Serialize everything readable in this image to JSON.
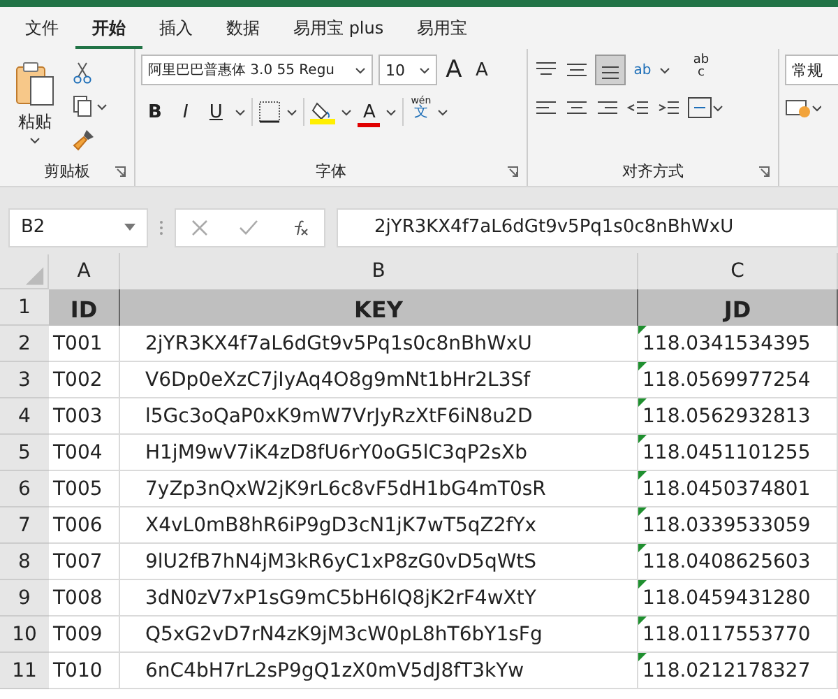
{
  "tabs": [
    {
      "label": "文件",
      "selected": false
    },
    {
      "label": "开始",
      "selected": true
    },
    {
      "label": "插入",
      "selected": false
    },
    {
      "label": "数据",
      "selected": false
    },
    {
      "label": "易用宝 plus",
      "selected": false
    },
    {
      "label": "易用宝",
      "selected": false
    }
  ],
  "ribbon": {
    "clipboard": {
      "paste_label": "粘贴",
      "group_label": "剪贴板"
    },
    "font": {
      "font_name": "阿里巴巴普惠体 3.0 55 Regu",
      "font_size": "10",
      "grow_label": "A",
      "shrink_label": "A",
      "style_buttons": [
        "B",
        "I",
        "U"
      ],
      "color_label": "A",
      "phonetic_label": "wén",
      "phonetic_char": "文",
      "group_label": "字体"
    },
    "alignment": {
      "orientation_label": "ab",
      "wrap_label": "ab",
      "wrap_label_2": "c",
      "group_label": "对齐方式"
    },
    "number": {
      "format": "常规"
    }
  },
  "formula_bar": {
    "name_box": "B2",
    "value": "2jYR3KX4f7aL6dGt9v5Pq1s0c8nBhWxU"
  },
  "sheet": {
    "columns": [
      "A",
      "B",
      "C"
    ],
    "header_row": {
      "number": "1",
      "cells": [
        "ID",
        "KEY",
        "JD"
      ]
    },
    "rows": [
      {
        "number": "2",
        "cells": [
          "T001",
          "2jYR3KX4f7aL6dGt9v5Pq1s0c8nBhWxU",
          "118.0341534395"
        ],
        "flagged": true
      },
      {
        "number": "3",
        "cells": [
          "T002",
          "V6Dp0eXzC7jIyAq4O8g9mNt1bHr2L3Sf",
          "118.0569977254"
        ],
        "flagged": true
      },
      {
        "number": "4",
        "cells": [
          "T003",
          "l5Gc3oQaP0xK9mW7VrJyRzXtF6iN8u2D",
          "118.0562932813"
        ],
        "flagged": true
      },
      {
        "number": "5",
        "cells": [
          "T004",
          "H1jM9wV7iK4zD8fU6rY0oG5lC3qP2sXb",
          "118.0451101255"
        ],
        "flagged": true
      },
      {
        "number": "6",
        "cells": [
          "T005",
          "7yZp3nQxW2jK9rL6c8vF5dH1bG4mT0sR",
          "118.0450374801"
        ],
        "flagged": true
      },
      {
        "number": "7",
        "cells": [
          "T006",
          "X4vL0mB8hR6iP9gD3cN1jK7wT5qZ2fYx",
          "118.0339533059"
        ],
        "flagged": true
      },
      {
        "number": "8",
        "cells": [
          "T007",
          "9lU2fB7hN4jM3kR6yC1xP8zG0vD5qWtS",
          "118.0408625603"
        ],
        "flagged": true
      },
      {
        "number": "9",
        "cells": [
          "T008",
          "3dN0zV7xP1sG9mC5bH6lQ8jK2rF4wXtY",
          "118.0459431280"
        ],
        "flagged": true
      },
      {
        "number": "10",
        "cells": [
          "T009",
          "Q5xG2vD7rN4zK9jM3cW0pL8hT6bY1sFg",
          "118.0117553770"
        ],
        "flagged": true
      },
      {
        "number": "11",
        "cells": [
          "T010",
          "6nC4bH7rL2sP9gQ1zX0mV5dJ8fT3kYw",
          "118.0212178327"
        ],
        "flagged": true
      }
    ]
  }
}
